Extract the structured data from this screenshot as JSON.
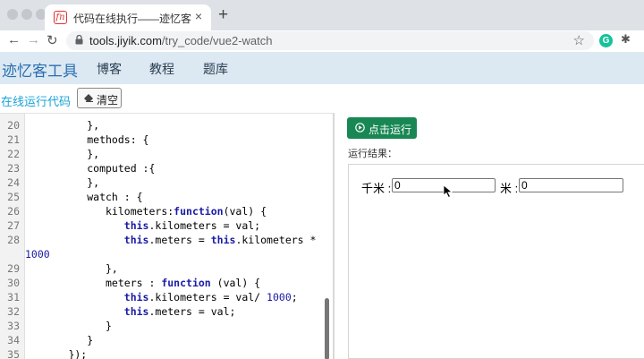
{
  "browser": {
    "tab_title": "代码在线执行——迹忆客",
    "favicon_glyph": "fn",
    "close_glyph": "×",
    "new_tab_glyph": "+",
    "back_glyph": "←",
    "forward_glyph": "→",
    "reload_glyph": "↻",
    "url_host": "tools.jiyik.com",
    "url_path": "/try_code/vue2-watch",
    "star_glyph": "☆",
    "extension_letter": "G",
    "puzzle_glyph": "✱",
    "icons": [
      "close-icon",
      "new-tab-icon",
      "back-icon",
      "forward-icon",
      "reload-icon",
      "lock-icon",
      "bookmark-star-icon",
      "grammarly-icon",
      "extensions-icon"
    ]
  },
  "site": {
    "logo": "迹忆客工具",
    "nav": [
      {
        "label": "博客"
      },
      {
        "label": "教程"
      },
      {
        "label": "题库"
      }
    ]
  },
  "toolbar": {
    "run_online_label": "在线运行代码",
    "clear_label": "清空"
  },
  "editor": {
    "lines": [
      {
        "n": "20",
        "text": "          },"
      },
      {
        "n": "21",
        "text": "          methods: {"
      },
      {
        "n": "22",
        "text": "          },"
      },
      {
        "n": "23",
        "text": "          computed :{"
      },
      {
        "n": "24",
        "text": "          },"
      },
      {
        "n": "25",
        "text": "          watch : {"
      },
      {
        "n": "26",
        "text": "             kilometers:function(val) {"
      },
      {
        "n": "27",
        "text": "                this.kilometers = val;"
      },
      {
        "n": "28",
        "text": "                this.meters = this.kilometers *"
      },
      {
        "n": "",
        "text": "1000"
      },
      {
        "n": "29",
        "text": "             },"
      },
      {
        "n": "30",
        "text": "             meters : function (val) {"
      },
      {
        "n": "31",
        "text": "                this.kilometers = val/ 1000;"
      },
      {
        "n": "32",
        "text": "                this.meters = val;"
      },
      {
        "n": "33",
        "text": "             }"
      },
      {
        "n": "34",
        "text": "          }"
      },
      {
        "n": "35",
        "text": "       });"
      }
    ]
  },
  "result": {
    "run_button_label": "点击运行",
    "result_label": "运行结果：",
    "km_label": "千米 :",
    "km_value": "0",
    "m_label": "米 :",
    "m_value": "0"
  },
  "colors": {
    "run_button": "#198754",
    "header_bg": "#dce9f3",
    "logo": "#2a6fb0",
    "run_online": "#1aa3d9",
    "keyword": "#1a1aa6"
  }
}
